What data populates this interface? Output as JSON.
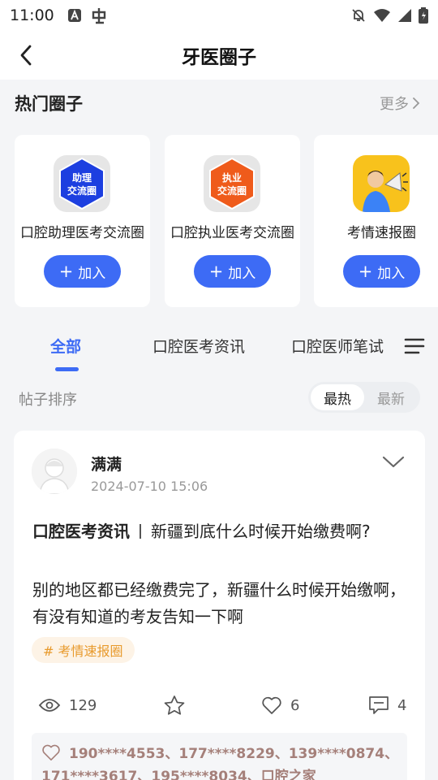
{
  "status_bar": {
    "time": "11:00"
  },
  "nav": {
    "title": "牙医圈子"
  },
  "hot_circles": {
    "title": "热门圈子",
    "more_label": "更多",
    "join_label": "加入",
    "items": [
      {
        "name": "口腔助理医考交流圈",
        "badge_line1": "助理",
        "badge_line2": "交流圈",
        "color": "#1d3fe0"
      },
      {
        "name": "口腔执业医考交流圈",
        "badge_line1": "执业",
        "badge_line2": "交流圈",
        "color": "#ef5b1b"
      },
      {
        "name": "考情速报圈",
        "color": "#f8c21c"
      }
    ]
  },
  "tabs": {
    "items": [
      "全部",
      "口腔医考资讯",
      "口腔医师笔试"
    ],
    "active": "全部"
  },
  "sort": {
    "label": "帖子排序",
    "options": [
      "最热",
      "最新"
    ],
    "selected": "最热"
  },
  "post": {
    "author": "满满",
    "time": "2024-07-10 15:06",
    "category": "口腔医考资讯",
    "title": "新疆到底什么时候开始缴费啊?",
    "body": "别的地区都已经缴费完了，新疆什么时候开始缴啊，有没有知道的考友告知一下啊",
    "tag": "# 考情速报圈",
    "views": "129",
    "likes": "6",
    "comments": "4",
    "liked_by": "190****4553、177****8229、139****0874、171****3617、195****8034、口腔之家"
  },
  "colors": {
    "accent": "#3d6bf5",
    "tag_text": "#e89a2c",
    "tag_bg": "#fdf3e6"
  }
}
